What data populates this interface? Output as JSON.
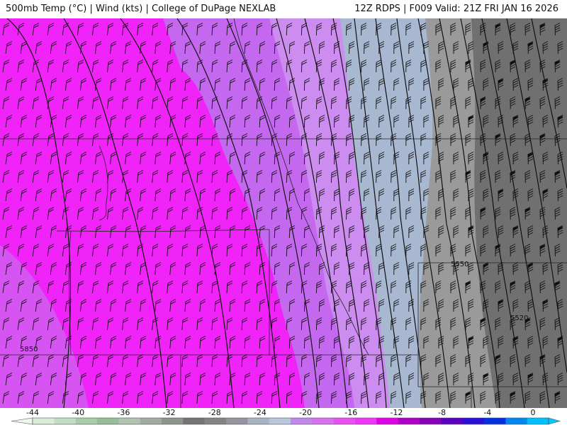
{
  "header": {
    "left": "500mb Temp (°C) | Wind (kts) | College of DuPage NEXLAB",
    "right": "12Z RDPS | F009 Valid: 21Z FRI JAN 16 2026"
  },
  "map": {
    "height_labels": [
      "5850",
      "5550",
      "5520"
    ]
  },
  "colorbar": {
    "tick_labels": [
      "-44",
      "-40",
      "-36",
      "-32",
      "-28",
      "-24",
      "-20",
      "-16",
      "-12",
      "-8",
      "-4",
      "0"
    ],
    "colors": [
      "#d8ecd8",
      "#c4dec4",
      "#a8cca8",
      "#98bc98",
      "#b0c4b0",
      "#a0aca0",
      "#8c948c",
      "#747474",
      "#848488",
      "#9494a0",
      "#a8b4c4",
      "#b8c8dc",
      "#c088e8",
      "#d870f0",
      "#e850f4",
      "#f034f8",
      "#e000e8",
      "#b000c8",
      "#8800b8",
      "#5c00c0",
      "#2810d8",
      "#0030e0",
      "#0088f0",
      "#00c0ff"
    ]
  },
  "colors": {
    "magenta": "#f024f8",
    "violet": "#c068f0",
    "light_violet": "#cc8cf0",
    "steel_blue": "#a8b8d0",
    "gray": "#9a9a9a",
    "dark_gray": "#6e6e6e"
  }
}
